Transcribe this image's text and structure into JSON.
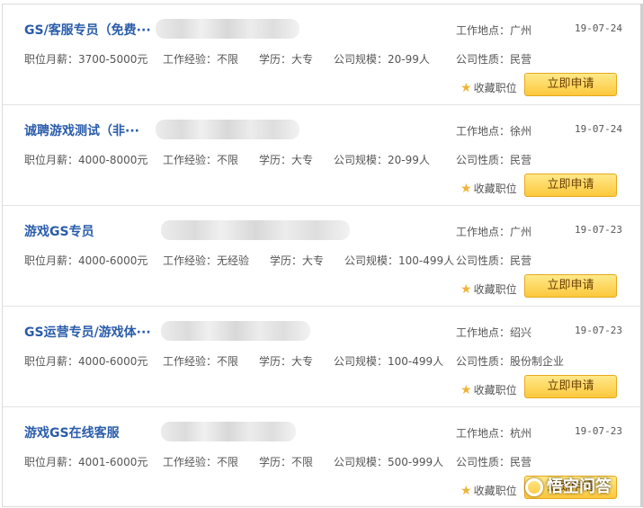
{
  "jobs": [
    {
      "title": "GS/客服专员（免费···",
      "salary": "职位月薪：3700-5000元",
      "experience": "工作经验：不限",
      "education": "学历：大专",
      "size": "公司规模：20-99人",
      "location": "工作地点：广州",
      "date": "19-07-24",
      "nature": "公司性质：民营",
      "favorite": "收藏职位",
      "apply": "立即申请"
    },
    {
      "title": "诚聘游戏测试（非···",
      "salary": "职位月薪：4000-8000元",
      "experience": "工作经验：不限",
      "education": "学历：大专",
      "size": "公司规模：20-99人",
      "location": "工作地点：徐州",
      "date": "19-07-24",
      "nature": "公司性质：民营",
      "favorite": "收藏职位",
      "apply": "立即申请"
    },
    {
      "title": "游戏GS专员",
      "salary": "职位月薪：4000-6000元",
      "experience": "工作经验：无经验",
      "education": "学历：大专",
      "size": "公司规模：100-499人",
      "location": "工作地点：广州",
      "date": "19-07-23",
      "nature": "公司性质：民营",
      "favorite": "收藏职位",
      "apply": "立即申请"
    },
    {
      "title": "GS运营专员/游戏体···",
      "salary": "职位月薪：4000-6000元",
      "experience": "工作经验：不限",
      "education": "学历：大专",
      "size": "公司规模：100-499人",
      "location": "工作地点：绍兴",
      "date": "19-07-23",
      "nature": "公司性质：股份制企业",
      "favorite": "收藏职位",
      "apply": "立即申请"
    },
    {
      "title": "游戏GS在线客服",
      "salary": "职位月薪：4001-6000元",
      "experience": "工作经验：不限",
      "education": "学历：不限",
      "size": "公司规模：500-999人",
      "location": "工作地点：杭州",
      "date": "19-07-23",
      "nature": "公司性质：民营",
      "favorite": "收藏职位",
      "apply": "立即申请"
    }
  ],
  "watermark": {
    "text": "悟空问答",
    "icon": "wukong-logo-icon"
  },
  "colors": {
    "title": "#2a5caa",
    "apply_button": "#fcc83c",
    "star": "#f0b43a"
  }
}
